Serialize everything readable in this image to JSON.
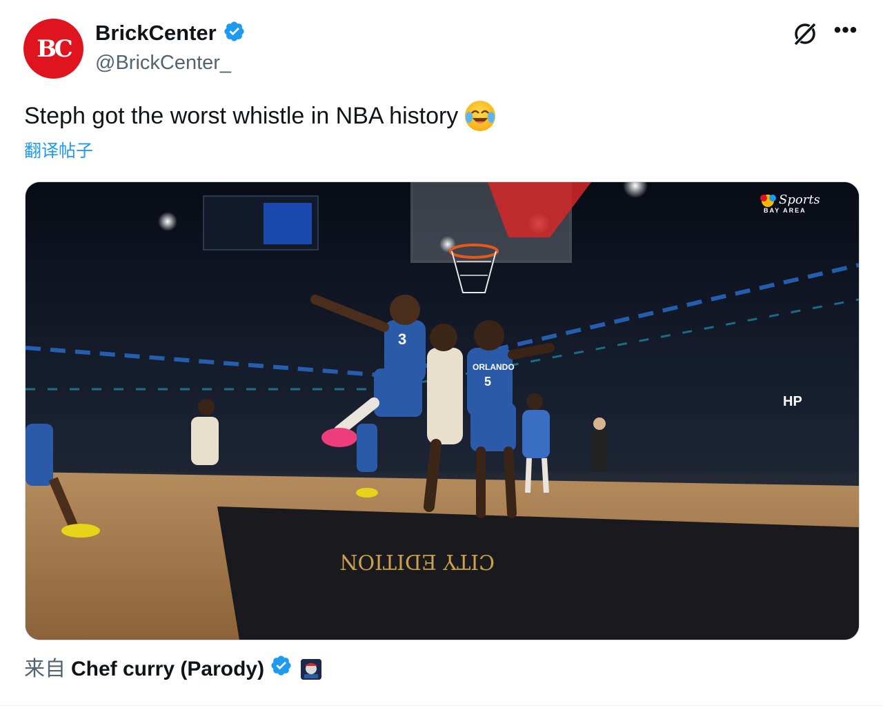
{
  "author": {
    "display_name": "BrickCenter",
    "handle": "@BrickCenter_",
    "avatar_text": "BC",
    "verified": true
  },
  "tweet": {
    "text": "Steph got the worst whistle in NBA history",
    "emoji": "face-with-tears-of-joy",
    "translate_label": "翻译帖子"
  },
  "media": {
    "description_icon": "video-frame",
    "broadcaster_logo": "NBC Sports Bay Area",
    "jersey_numbers": [
      "3",
      "5"
    ],
    "court_text": "CITY EDITION",
    "jersey_team": "ORLANDO",
    "arena_sign": "HP"
  },
  "source": {
    "prefix": "来自",
    "name": "Chef curry (Parody)",
    "verified": true
  },
  "colors": {
    "verified": "#1d9bf0",
    "link": "#1d9bf0",
    "avatar_bg": "#e0141e",
    "secondary_text": "#536471"
  }
}
